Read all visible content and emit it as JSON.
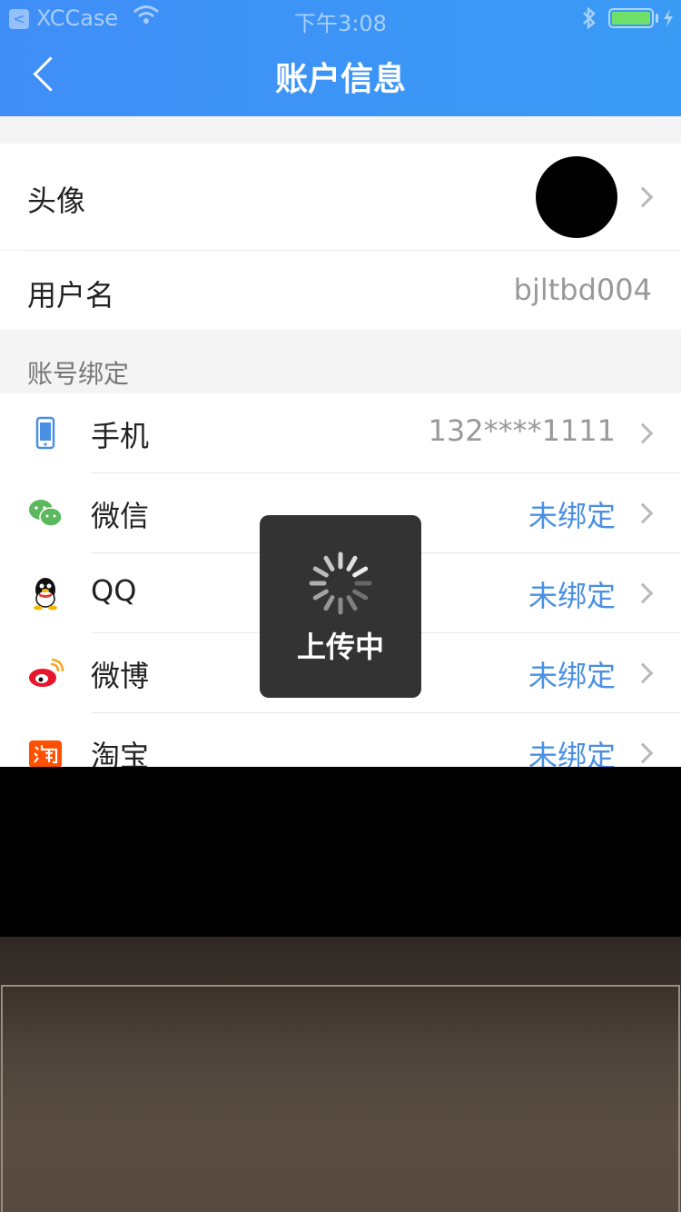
{
  "status_bar": {
    "back_glyph": "<",
    "carrier": "XCCase",
    "time": "下午3:08",
    "bluetooth_icon": "bluetooth-icon",
    "battery_color": "#6fe06a"
  },
  "nav": {
    "title": "账户信息",
    "back_icon": "back-chevron-icon",
    "color": "#3f8ef7"
  },
  "profile": {
    "avatar_label": "头像",
    "username_label": "用户名",
    "username_value": "bjltbd004"
  },
  "bindings": {
    "section_title": "账号绑定",
    "items": [
      {
        "icon": "phone-icon",
        "label": "手机",
        "value": "132****1111",
        "status": "bound"
      },
      {
        "icon": "wechat-icon",
        "label": "微信",
        "value": "未绑定",
        "status": "unbound"
      },
      {
        "icon": "qq-icon",
        "label": "QQ",
        "value": "未绑定",
        "status": "unbound"
      },
      {
        "icon": "weibo-icon",
        "label": "微博",
        "value": "未绑定",
        "status": "unbound"
      },
      {
        "icon": "taobao-icon",
        "label": "淘宝",
        "value": "未绑定",
        "status": "unbound"
      }
    ]
  },
  "toast": {
    "text": "上传中",
    "icon": "loading-spinner-icon"
  },
  "colors": {
    "accent": "#4a90e2",
    "header": "#3f8ef7",
    "wechat": "#5cb85c",
    "weibo": "#e6162d",
    "taobao": "#ff5000"
  }
}
